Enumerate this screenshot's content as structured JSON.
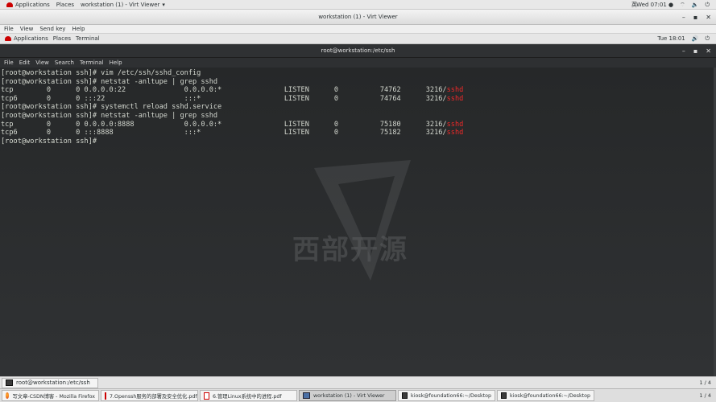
{
  "host_top_bar": {
    "applications": "Applications",
    "places": "Places",
    "active_window": "workstation (1) - Virt Viewer",
    "input_method": "英",
    "clock": "Wed 07:01 ●"
  },
  "viewer_window": {
    "title": "workstation (1) - Virt Viewer",
    "minimize": "–",
    "maximize": "▪",
    "close": "✕",
    "menu": [
      "File",
      "View",
      "Send key",
      "Help"
    ]
  },
  "guest_top_panel": {
    "applications": "Applications",
    "places": "Places",
    "terminal": "Terminal",
    "clock": "Tue 18:01",
    "volume": "🔊",
    "power": "⏻"
  },
  "terminal": {
    "title": "root@workstation:/etc/ssh",
    "menu": [
      "File",
      "Edit",
      "View",
      "Search",
      "Terminal",
      "Help"
    ],
    "lines": [
      {
        "text": "[root@workstation ssh]# vim /etc/ssh/sshd_config",
        "proc": ""
      },
      {
        "text": "[root@workstation ssh]# netstat -anltupe | grep sshd",
        "proc": ""
      },
      {
        "text": "tcp        0      0 0.0.0.0:22              0.0.0.0:*               LISTEN      0          74762      3216/",
        "proc": "sshd"
      },
      {
        "text": "tcp6       0      0 :::22                   :::*                    LISTEN      0          74764      3216/",
        "proc": "sshd"
      },
      {
        "text": "[root@workstation ssh]# systemctl reload sshd.service",
        "proc": ""
      },
      {
        "text": "[root@workstation ssh]# netstat -anltupe | grep sshd",
        "proc": ""
      },
      {
        "text": "tcp        0      0 0.0.0.0:8888            0.0.0.0:*               LISTEN      0          75180      3216/",
        "proc": "sshd"
      },
      {
        "text": "tcp6       0      0 :::8888                 :::*                    LISTEN      0          75182      3216/",
        "proc": "sshd"
      },
      {
        "text": "[root@workstation ssh]# ",
        "proc": ""
      }
    ]
  },
  "watermark": {
    "text": "西部开源"
  },
  "guest_taskbar": {
    "task": "root@workstation:/etc/ssh",
    "pager": "1 / 4"
  },
  "host_taskbar": {
    "tasks": [
      "写文章-CSDN博客 - Mozilla Firefox",
      "7.Openssh服务的部署及安全优化.pdf",
      "6.管理Linux系统中的进程.pdf",
      "workstation (1) - Virt Viewer",
      "kiosk@foundation66:~/Desktop",
      "kiosk@foundation66:~/Desktop"
    ],
    "pager": "1 / 4"
  },
  "colors": {
    "terminal_bg": "#2b2d2f",
    "terminal_fg": "#d3d7cf",
    "process_name": "#ef2929"
  }
}
